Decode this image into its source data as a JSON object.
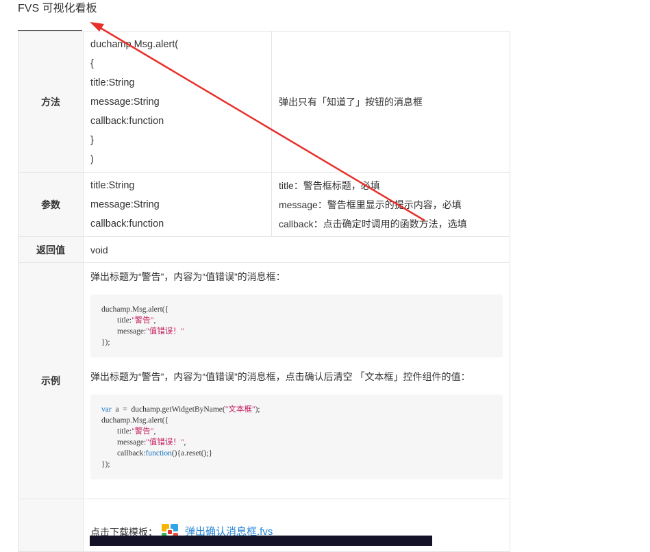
{
  "page": {
    "title": "FVS 可视化看板"
  },
  "method": {
    "label": "方法",
    "code_lines": [
      "duchamp.Msg.alert(",
      "{",
      "title:String",
      "message:String",
      "callback:function",
      "}",
      ")"
    ],
    "description": "弹出只有「知道了」按钮的消息框"
  },
  "params": {
    "label": "参数",
    "names": [
      "title:String",
      "message:String",
      "callback:function"
    ],
    "descriptions": [
      "title：警告框标题，必填",
      "message：警告框里显示的提示内容，必填",
      "callback：点击确定时调用的函数方法，选填"
    ]
  },
  "returns": {
    "label": "返回值",
    "value": "void"
  },
  "examples": {
    "label": "示例",
    "example1": {
      "text": "弹出标题为“警告”，内容为“值错误”的消息框：",
      "code": {
        "l1": "duchamp.Msg.alert({",
        "l2_key": "        title:",
        "l2_val": "\"警告\"",
        "l2_end": ",",
        "l3_key": "        message:",
        "l3_val": "\"值错误！\"",
        "l4": "});"
      }
    },
    "example2": {
      "text": "弹出标题为“警告”，内容为“值错误”的消息框，点击确认后清空 「文本框」控件组件的值：",
      "code": {
        "l1_kw": "var",
        "l1_rest": "  a  =  duchamp.getWidgetByName(",
        "l1_str": "\"文本框\"",
        "l1_end": ");",
        "l2": "duchamp.Msg.alert({",
        "l3_key": "        title:",
        "l3_val": "\"警告\"",
        "l3_end": ",",
        "l4_key": "        message:",
        "l4_val": "\"值错误！\"",
        "l4_end": ",",
        "l5_key": "        callback:",
        "l5_kw": "function",
        "l5_end": "(){a.reset();}",
        "l6": "});"
      }
    }
  },
  "download": {
    "prefix": "点击下载模板：",
    "file_name": "弹出确认消息框.fvs",
    "icon": "fvs-file-icon"
  },
  "colors": {
    "annotation_arrow": "#e8302a",
    "link": "#2383d8",
    "code_keyword": "#0f6fbf",
    "code_string": "#c21a5c"
  }
}
